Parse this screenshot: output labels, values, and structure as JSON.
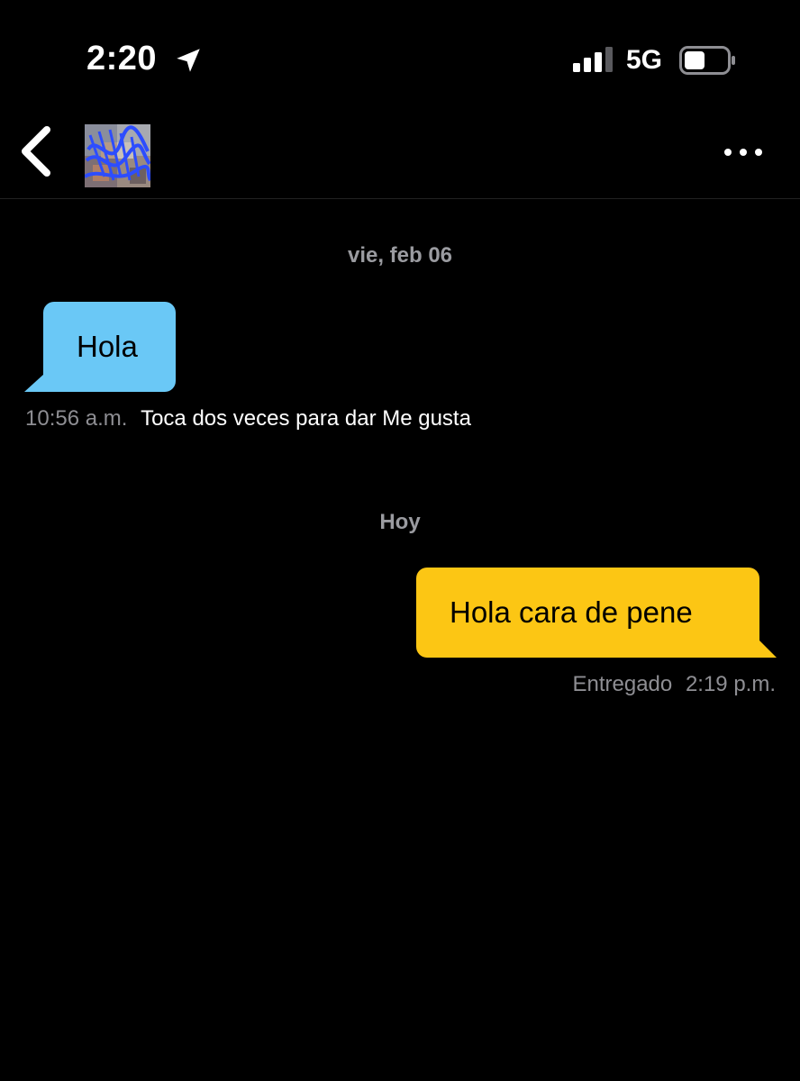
{
  "status_bar": {
    "time": "2:20",
    "network": "5G"
  },
  "icons": {
    "location": "location-arrow-icon",
    "signal": "cellular-signal-icon",
    "battery": "battery-icon",
    "back": "chevron-left-icon",
    "more": "ellipsis-icon"
  },
  "conversation": {
    "date_1": "vie, feb 06",
    "incoming_message": {
      "text": "Hola",
      "time": "10:56 a.m.",
      "hint": "Toca dos veces para dar Me gusta"
    },
    "date_2": "Hoy",
    "outgoing_message": {
      "text": "Hola cara de pene",
      "status": "Entregado",
      "time": "2:19 p.m."
    }
  },
  "colors": {
    "background": "#000000",
    "incoming_bubble": "#6ac8f6",
    "outgoing_bubble": "#fcc614",
    "meta_text": "#8e8e93"
  }
}
